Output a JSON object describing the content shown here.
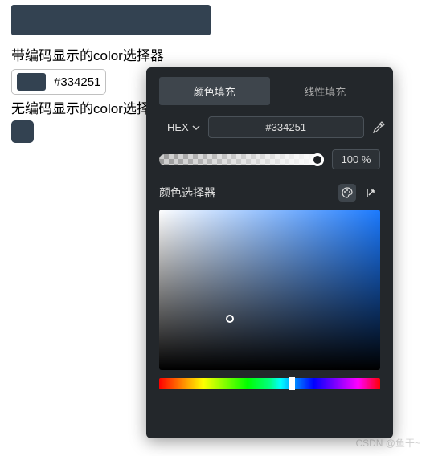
{
  "labels": {
    "with_code": "带编码显示的color选择器",
    "without_code": "无编码显示的color选择器"
  },
  "swatch": {
    "color": "#334251",
    "code": "#334251"
  },
  "picker": {
    "tabs": {
      "solid": "颜色填充",
      "gradient": "线性填充"
    },
    "format_label": "HEX",
    "hex_value": "#334251",
    "opacity_display": "100 %",
    "section_title": "颜色选择器"
  },
  "watermark": "CSDN @鱼干~"
}
